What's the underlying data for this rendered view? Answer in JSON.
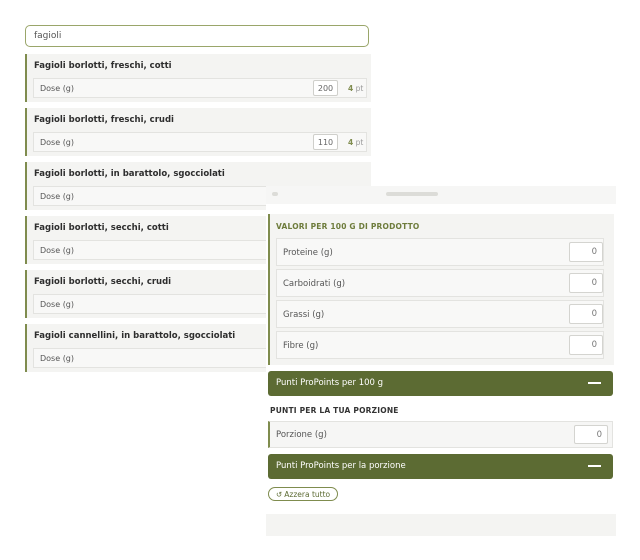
{
  "search": {
    "value": "fagioli"
  },
  "foods": [
    {
      "name": "Fagioli borlotti, freschi, cotti",
      "dose_label": "Dose (g)",
      "dose": "200",
      "points": "4",
      "points_unit": "pt"
    },
    {
      "name": "Fagioli borlotti, freschi, crudi",
      "dose_label": "Dose (g)",
      "dose": "110",
      "points": "4",
      "points_unit": "pt"
    },
    {
      "name": "Fagioli borlotti, in barattolo, sgocciolati",
      "dose_label": "Dose (g)"
    },
    {
      "name": "Fagioli borlotti, secchi, cotti",
      "dose_label": "Dose (g)"
    },
    {
      "name": "Fagioli borlotti, secchi, crudi",
      "dose_label": "Dose (g)"
    },
    {
      "name": "Fagioli cannellini, in barattolo, sgocciolati",
      "dose_label": "Dose (g)"
    }
  ],
  "calculator": {
    "values_title": "VALORI PER 100 G DI PRODOTTO",
    "fields": [
      {
        "label": "Proteine (g)",
        "value": "0"
      },
      {
        "label": "Carboidrati (g)",
        "value": "0"
      },
      {
        "label": "Grassi (g)",
        "value": "0"
      },
      {
        "label": "Fibre (g)",
        "value": "0"
      }
    ],
    "result_100g_label": "Punti ProPoints per 100 g",
    "portion_title": "PUNTI PER LA TUA PORZIONE",
    "portion_label": "Porzione (g)",
    "portion_value": "0",
    "result_portion_label": "Punti ProPoints per la porzione",
    "reset_label": "Azzera tutto"
  },
  "colors": {
    "accent": "#7f8c4e",
    "bar": "#5c6b33",
    "panel": "#f4f4f2"
  },
  "icons": {
    "reset": "refresh-icon",
    "collapse": "minus-icon"
  }
}
